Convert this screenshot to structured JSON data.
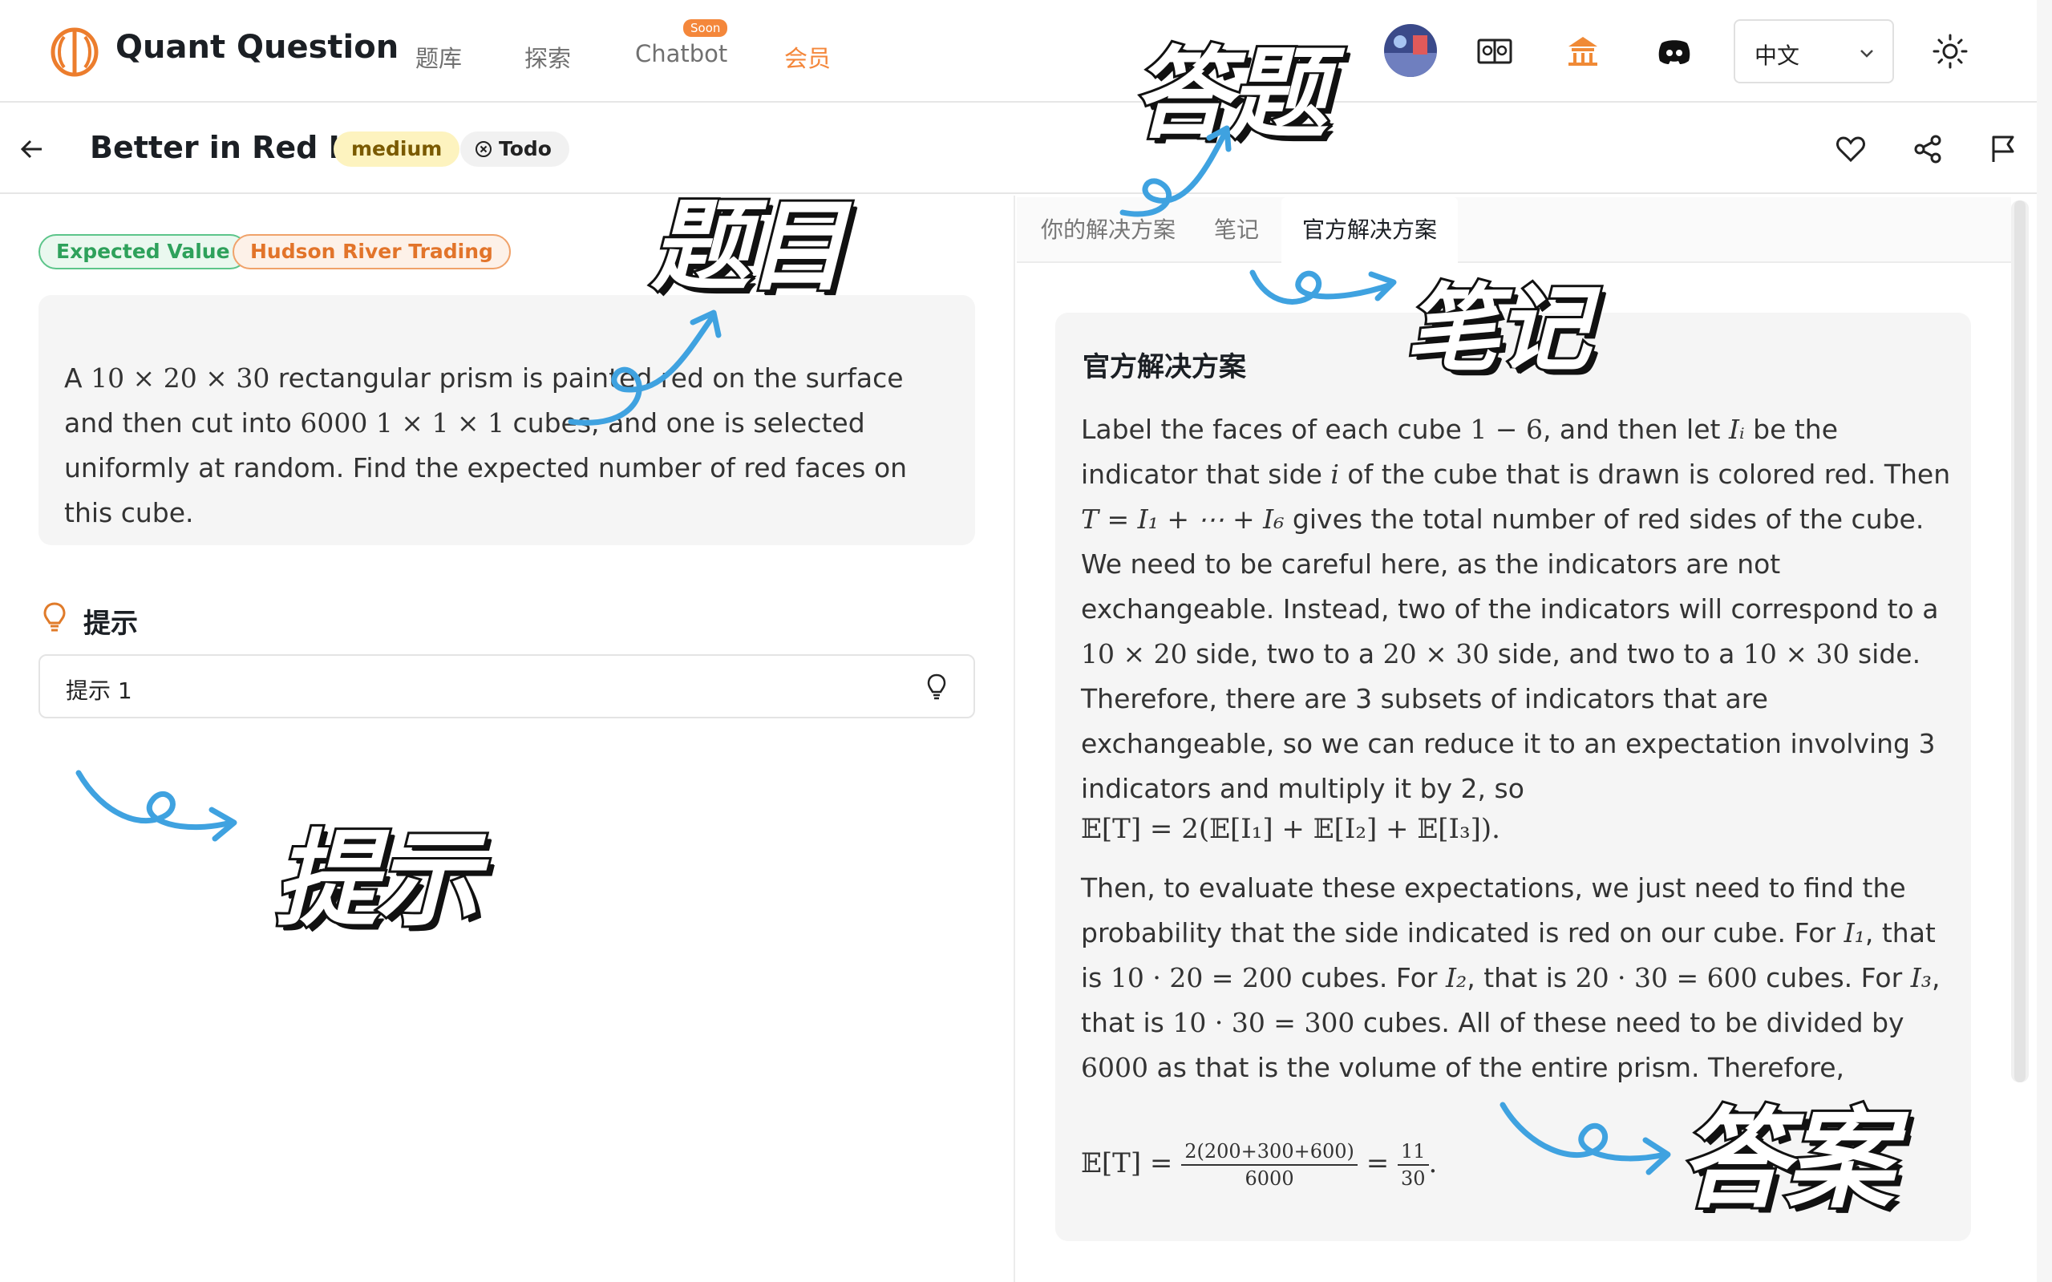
{
  "nav": {
    "brand": "Quant Question",
    "links": [
      "题库",
      "探索",
      "Chatbot",
      "会员"
    ],
    "soon_badge": "Soon",
    "language": "中文",
    "accent_color": "#f4873b",
    "icons": [
      "brain-logo-icon",
      "avatar",
      "book-icon",
      "temple-icon",
      "discord-icon",
      "chevron-down-icon",
      "sun-icon"
    ]
  },
  "question": {
    "title": "Better in Red II",
    "difficulty": "medium",
    "status": "Todo",
    "tags": [
      "Expected Value",
      "Hudson River Trading"
    ],
    "text_parts": {
      "a": "A ",
      "dims": "10 × 20 × 30",
      "b": " rectangular prism is painted red on the surface and then cut into ",
      "count": "6000",
      "c": " ",
      "unit": "1 × 1 × 1",
      "d": " cubes, and one is selected uniformly at random. Find the expected number of red faces on this cube."
    }
  },
  "hints": {
    "heading": "提示",
    "items": [
      "提示 1"
    ]
  },
  "solution": {
    "tabs": [
      "你的解决方案",
      "笔记",
      "官方解决方案"
    ],
    "active_tab": 2,
    "title": "官方解决方案",
    "p1_parts": {
      "a": "Label the faces of each cube ",
      "m1": "1 − 6",
      "b": ", and then let ",
      "m2": "Iᵢ",
      "c": " be the indicator that side ",
      "m3": "i",
      "d": " of the cube that is drawn is colored red. Then ",
      "m4": "T = I₁ + ⋯ + I₆",
      "e": " gives the total number of red sides of the cube. We need to be careful here, as the indicators are not exchangeable. Instead, two of the indicators will correspond to a ",
      "m5": "10 × 20",
      "f": " side, two to a ",
      "m6": "20 × 30",
      "g": " side, and two to a ",
      "m7": "10 × 30",
      "h": " side. Therefore, there are 3 subsets of indicators that are exchangeable, so we can reduce it to an expectation involving 3 indicators and multiply it by 2, so"
    },
    "eq1": "𝔼[T] = 2(𝔼[I₁] + 𝔼[I₂] + 𝔼[I₃]).",
    "p2_parts": {
      "a": "Then, to evaluate these expectations, we just need to find the probability that the side indicated is red on our cube. For ",
      "m1": "I₁",
      "b": ", that is ",
      "m2": "10 · 20 = 200",
      "c": " cubes. For ",
      "m3": "I₂",
      "d": ", that is ",
      "m4": "20 · 30 = 600",
      "e": " cubes. For ",
      "m5": "I₃",
      "f": ", that is ",
      "m6": "10 · 30 = 300",
      "g": " cubes. All of these need to be divided by ",
      "m7": "6000",
      "h": " as that is the volume of the entire prism. Therefore,"
    },
    "eq2": {
      "lhs": "𝔼[T] =",
      "num": "2(200+300+600)",
      "den": "6000",
      "eqs": "=",
      "num2": "11",
      "den2": "30",
      "end": "."
    }
  },
  "annotations": {
    "answer_q": "答题",
    "question": "题目",
    "notes": "笔记",
    "hint": "提示",
    "answer": "答案",
    "arrow_color": "#3fa2e0"
  }
}
